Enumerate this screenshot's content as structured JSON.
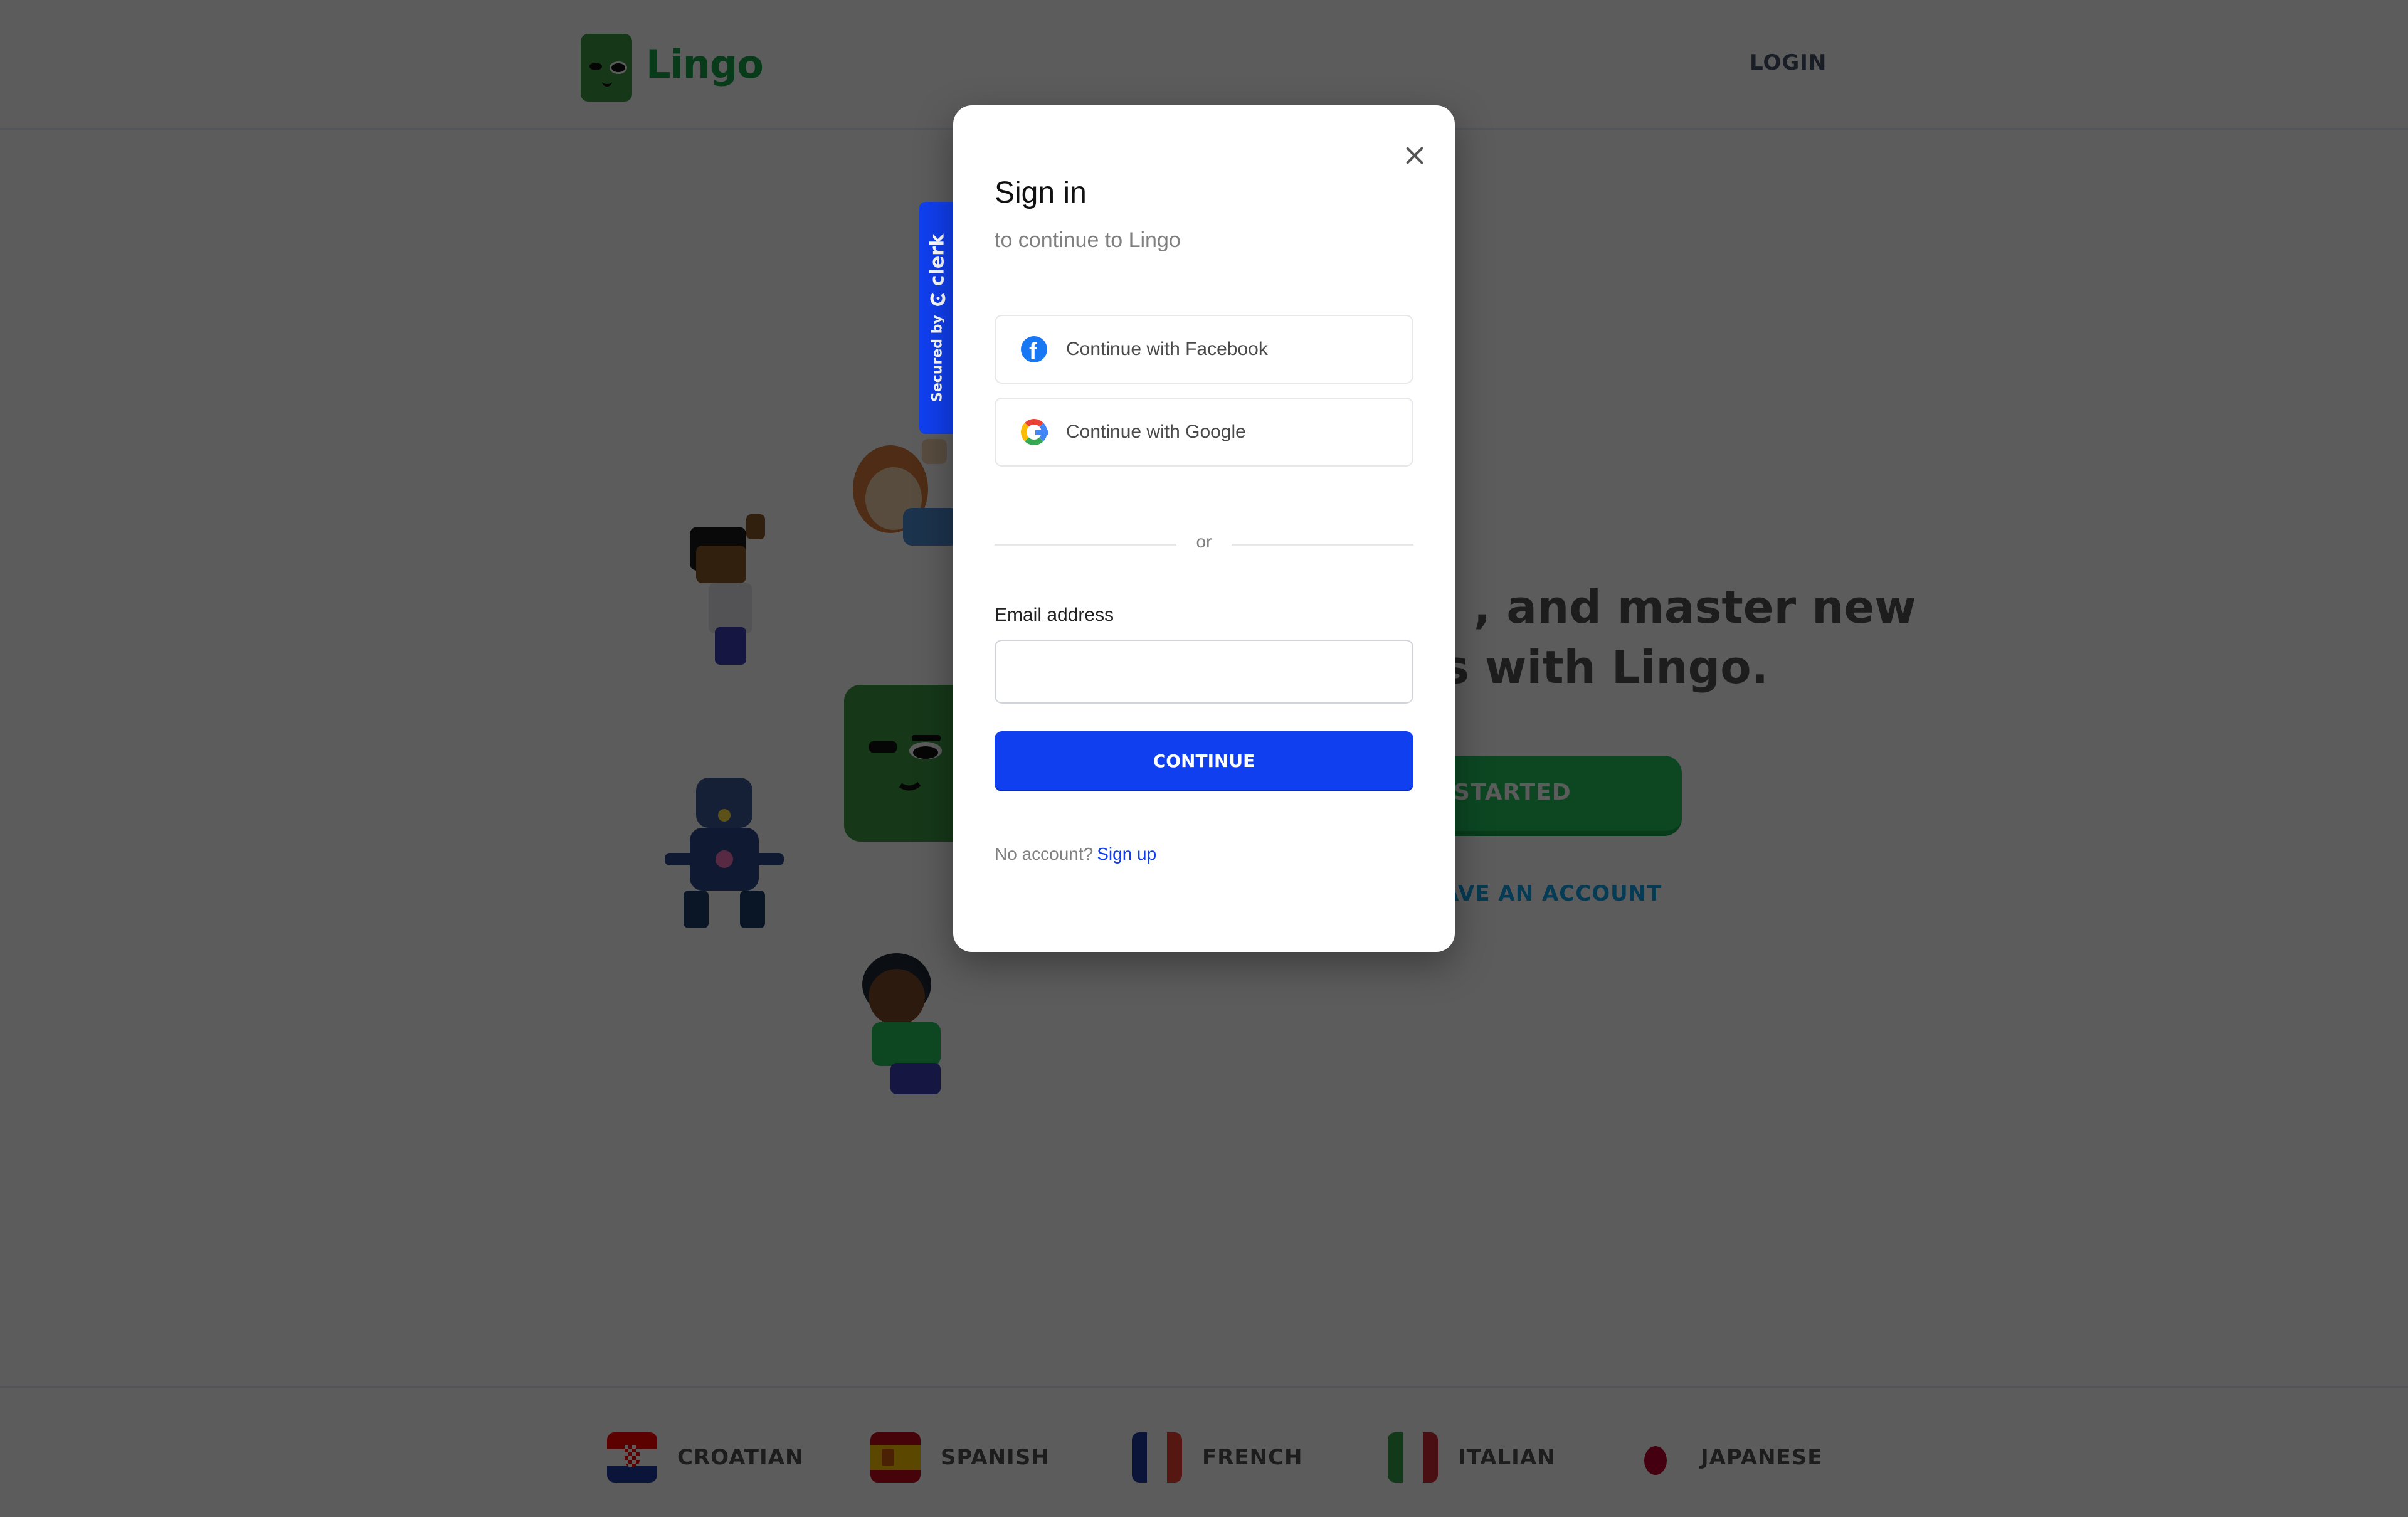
{
  "header": {
    "brand_name": "Lingo",
    "login_label": "LOGIN"
  },
  "hero": {
    "headline_visible_line1": ", and master new",
    "headline_visible_line2": "s with Lingo.",
    "get_started_visible": "STARTED",
    "have_account_visible": "AVE AN ACCOUNT",
    "colors": {
      "primary_green": "#22c55e",
      "link_blue": "#0ea5e9"
    }
  },
  "footer": {
    "languages": [
      {
        "name": "CROATIAN",
        "flag": "croatia-flag"
      },
      {
        "name": "SPANISH",
        "flag": "spain-flag"
      },
      {
        "name": "FRENCH",
        "flag": "france-flag"
      },
      {
        "name": "ITALIAN",
        "flag": "italy-flag"
      },
      {
        "name": "JAPANESE",
        "flag": "japan-flag"
      }
    ]
  },
  "clerk_badge": {
    "secured_by": "Secured by",
    "brand": "clerk",
    "color": "#103fef"
  },
  "modal": {
    "title": "Sign in",
    "subtitle": "to continue to Lingo",
    "social_buttons": [
      {
        "label": "Continue with Facebook",
        "icon": "facebook-icon"
      },
      {
        "label": "Continue with Google",
        "icon": "google-icon"
      }
    ],
    "divider_text": "or",
    "email": {
      "label": "Email address",
      "value": "",
      "placeholder": ""
    },
    "continue_label": "CONTINUE",
    "no_account_text": "No account?",
    "sign_up_label": "Sign up",
    "accent_color": "#103fef"
  }
}
